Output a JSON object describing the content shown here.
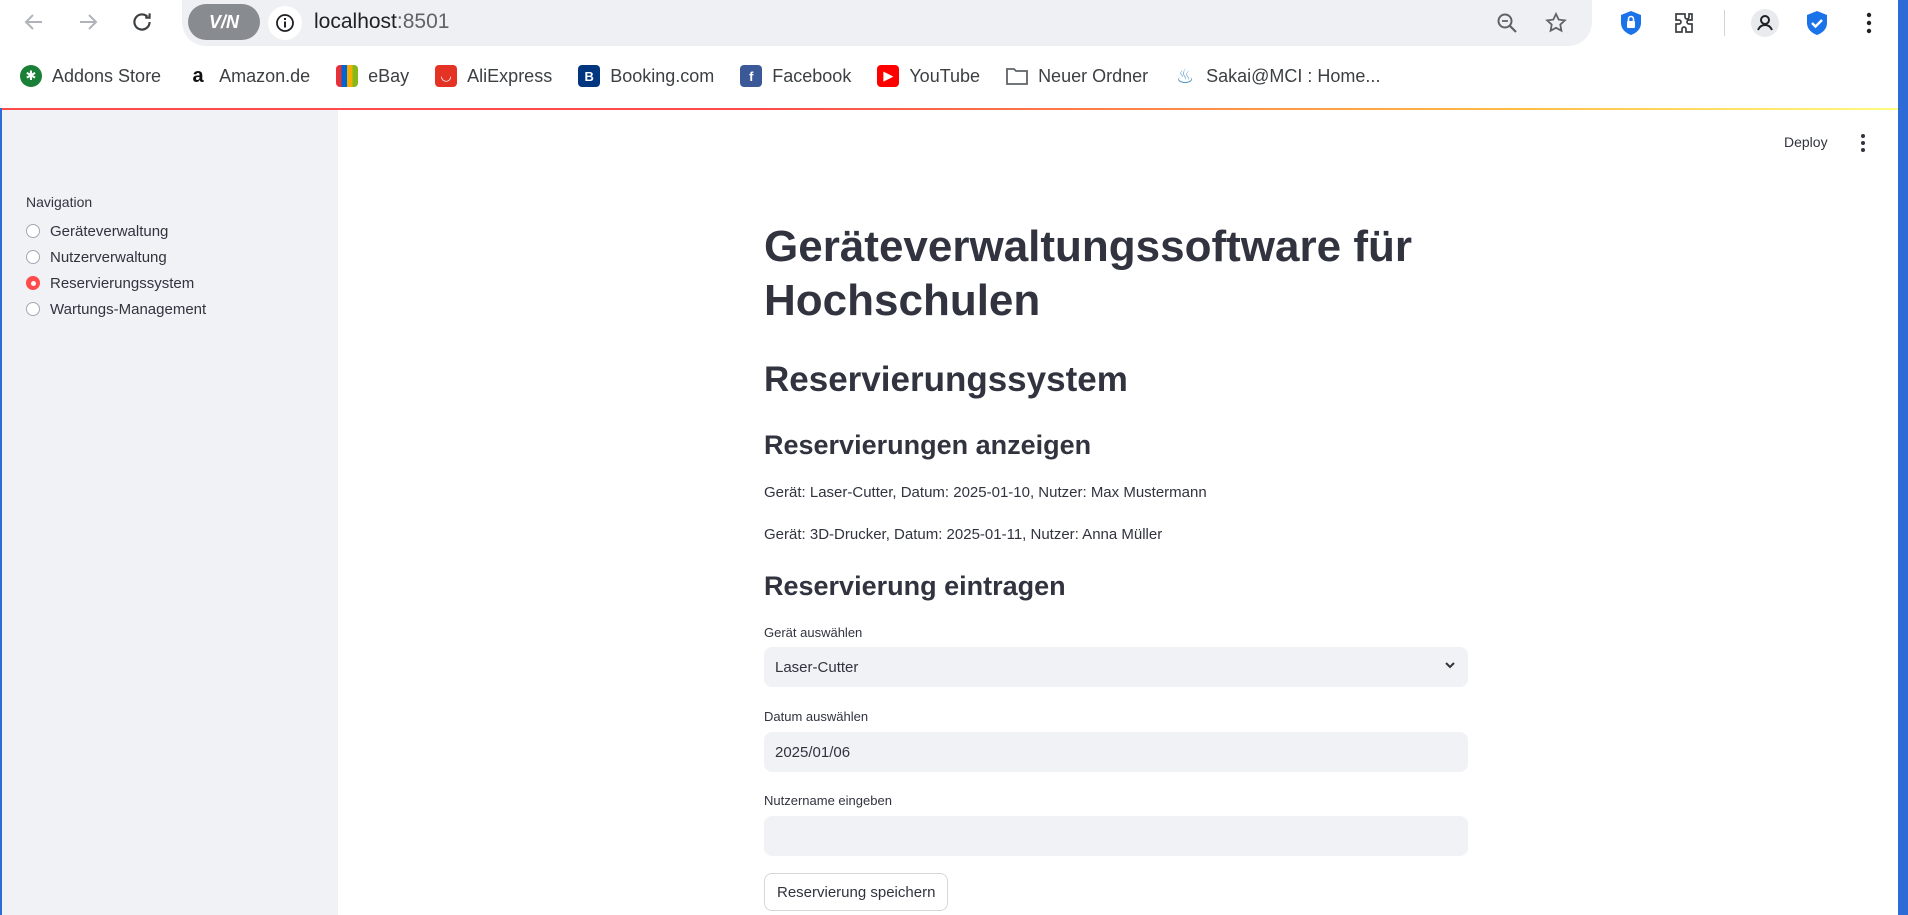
{
  "browser": {
    "url_host": "localhost",
    "url_port": ":8501",
    "vpn_label": "V/N"
  },
  "bookmarks": [
    {
      "label": "Addons Store",
      "icon": "addons-store-icon",
      "color": "#1a7f37"
    },
    {
      "label": "Amazon.de",
      "icon": "amazon-icon",
      "color": "#222222"
    },
    {
      "label": "eBay",
      "icon": "ebay-icon",
      "color": "#e53238"
    },
    {
      "label": "AliExpress",
      "icon": "aliexpress-icon",
      "color": "#e43225"
    },
    {
      "label": "Booking.com",
      "icon": "booking-icon",
      "color": "#003580"
    },
    {
      "label": "Facebook",
      "icon": "facebook-icon",
      "color": "#3b5998"
    },
    {
      "label": "YouTube",
      "icon": "youtube-icon",
      "color": "#ff0000"
    },
    {
      "label": "Neuer Ordner",
      "icon": "folder-icon",
      "color": "#5f6368"
    },
    {
      "label": "Sakai@MCI : Home...",
      "icon": "sakai-icon",
      "color": "#4a90c2"
    }
  ],
  "app": {
    "deploy_label": "Deploy",
    "sidebar": {
      "nav_label": "Navigation",
      "items": [
        {
          "label": "Geräteverwaltung",
          "selected": false
        },
        {
          "label": "Nutzerverwaltung",
          "selected": false
        },
        {
          "label": "Reservierungssystem",
          "selected": true
        },
        {
          "label": "Wartungs-Management",
          "selected": false
        }
      ]
    },
    "title": "Geräteverwaltungssoftware für Hochschulen",
    "subtitle": "Reservierungssystem",
    "list_heading": "Reservierungen anzeigen",
    "reservations": [
      "Gerät: Laser-Cutter, Datum: 2025-01-10, Nutzer: Max Mustermann",
      "Gerät: 3D-Drucker, Datum: 2025-01-11, Nutzer: Anna Müller"
    ],
    "form_heading": "Reservierung eintragen",
    "device_label": "Gerät auswählen",
    "device_value": "Laser-Cutter",
    "date_label": "Datum auswählen",
    "date_value": "2025/01/06",
    "user_label": "Nutzername eingeben",
    "user_value": "",
    "save_label": "Reservierung speichern"
  },
  "colors": {
    "accent": "#ff4b4b",
    "sidebar_bg": "#f0f2f6",
    "text": "#31333f"
  }
}
